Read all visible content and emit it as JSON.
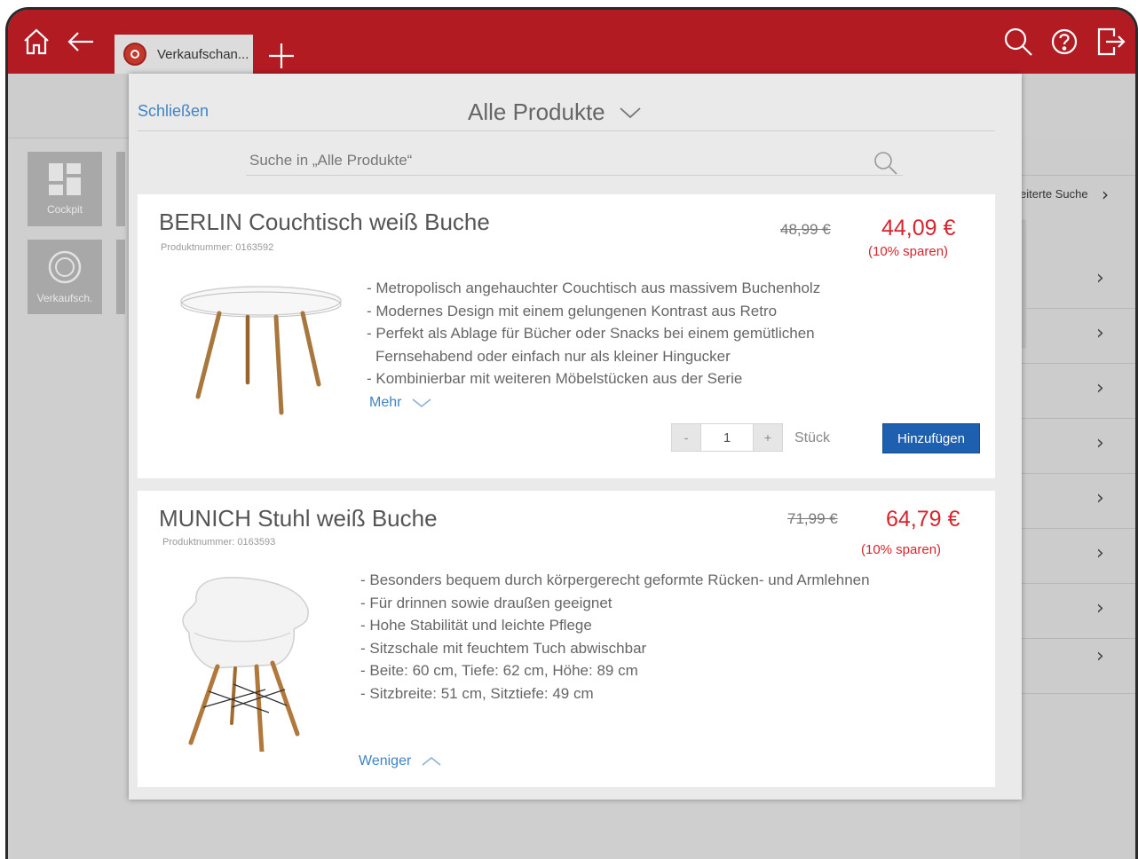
{
  "topbar": {
    "tab_label": "Verkaufschan...",
    "brand_color": "#b31b22",
    "icons": [
      "home-icon",
      "back-arrow-icon",
      "plus-icon",
      "search-icon",
      "help-icon",
      "logout-icon"
    ]
  },
  "background": {
    "tiles": [
      {
        "label": "Cockpit",
        "icon": "dashboard-icon"
      },
      {
        "label": "Verkaufsch.",
        "icon": "badge-icon"
      }
    ],
    "advanced_search": "eiterte Suche"
  },
  "modal": {
    "close_label": "Schließen",
    "title": "Alle Produkte",
    "search_placeholder": "Suche in „Alle Produkte“"
  },
  "products": [
    {
      "title": "BERLIN Couchtisch weiß Buche",
      "product_number": "Produktnummer: 0163592",
      "old_price": "48,99 €",
      "new_price": "44,09 €",
      "saving": "(10% sparen)",
      "description": [
        "- Metropolisch angehauchter Couchtisch aus massivem Buchenholz",
        "- Modernes Design mit einem gelungenen Kontrast aus Retro",
        "- Perfekt als Ablage für Bücher oder Snacks bei einem gemütlichen",
        "  Fernsehabend oder einfach nur als kleiner Hingucker",
        "- Kombinierbar mit weiteren Möbelstücken aus der Serie"
      ],
      "toggle_label": "Mehr",
      "qty_minus": "-",
      "qty_value": "1",
      "qty_plus": "+",
      "unit": "Stück",
      "add_label": "Hinzufügen"
    },
    {
      "title": "MUNICH Stuhl weiß Buche",
      "product_number": "Produktnummer: 0163593",
      "old_price": "71,99 €",
      "new_price": "64,79 €",
      "saving": "(10% sparen)",
      "description": [
        "- Besonders bequem durch körpergerecht geformte Rücken- und Armlehnen",
        "- Für drinnen sowie draußen geeignet",
        "- Hohe Stabilität und leichte Pflege",
        "- Sitzschale mit feuchtem Tuch abwischbar",
        "- Beite: 60 cm, Tiefe: 62 cm, Höhe: 89 cm",
        "- Sitzbreite: 51 cm, Sitztiefe: 49 cm"
      ],
      "toggle_label": "Weniger"
    }
  ],
  "colors": {
    "price_red": "#d6252f",
    "link_blue": "#3f84c6",
    "button_blue": "#1f5fb0"
  }
}
